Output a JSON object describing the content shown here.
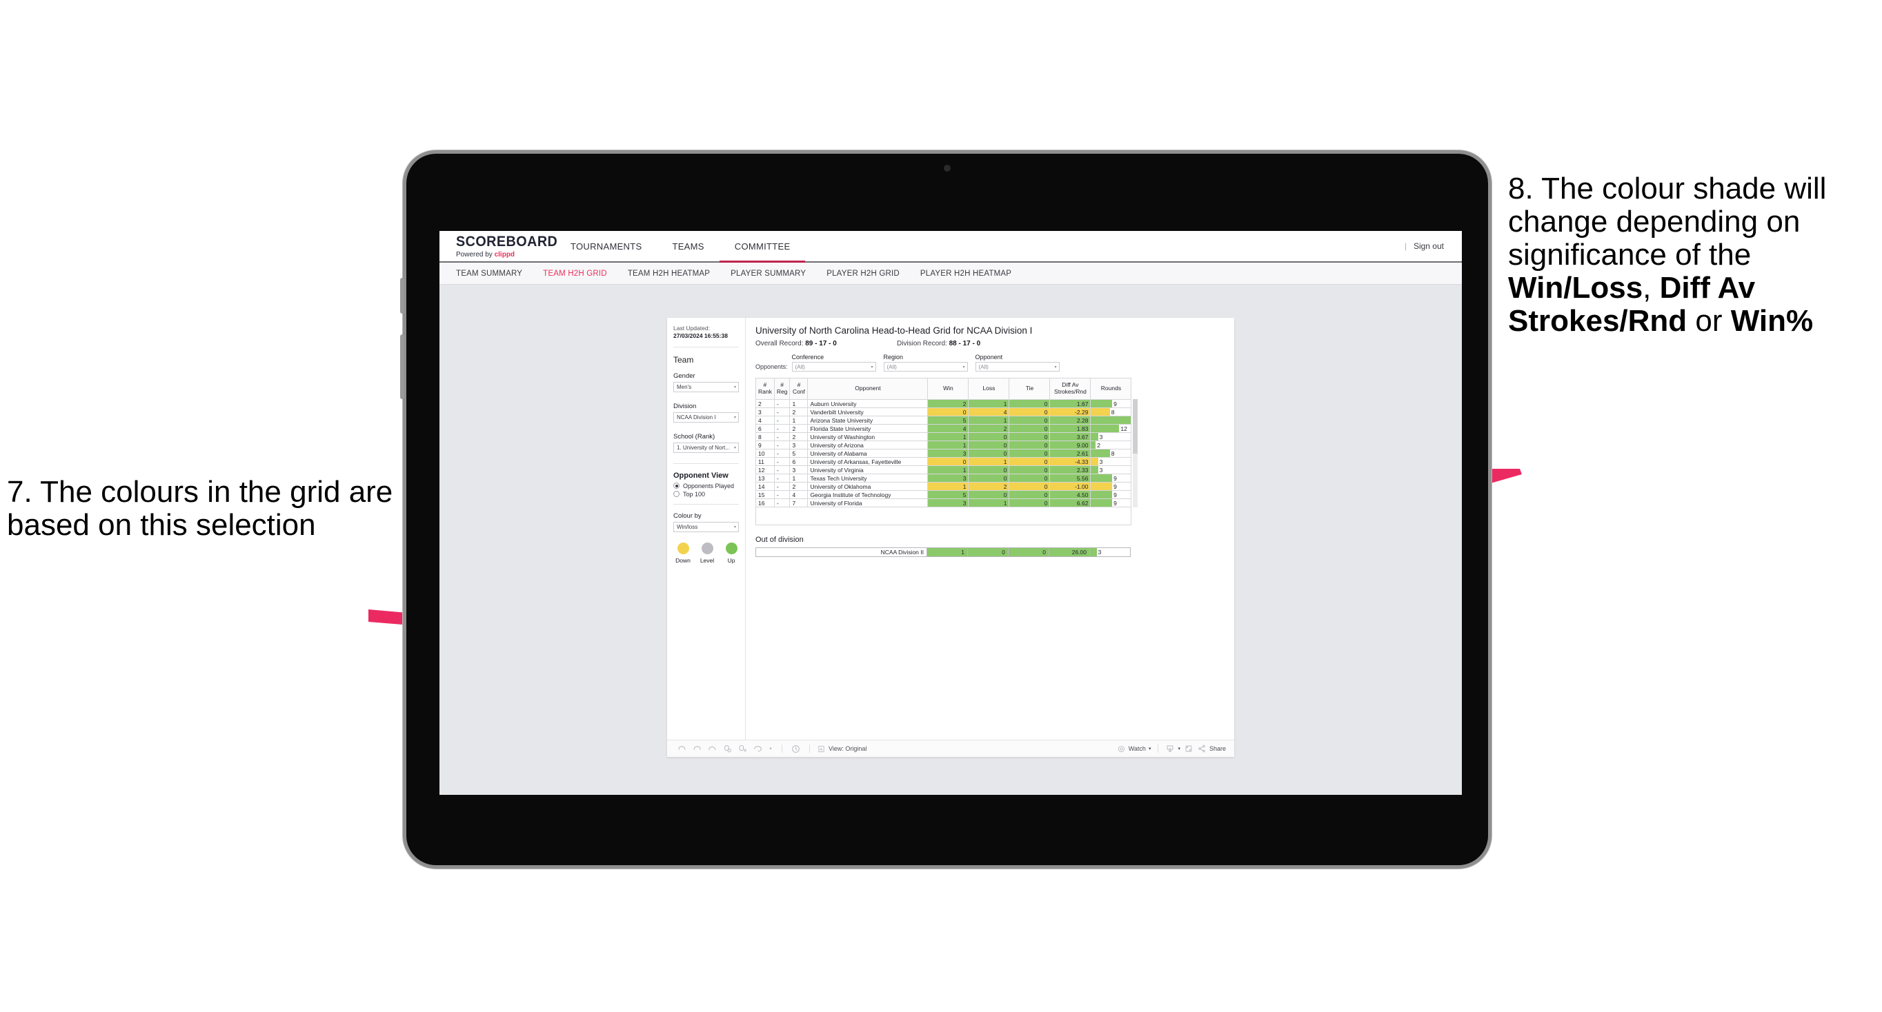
{
  "annotations": {
    "left": "7. The colours in the grid are based on this selection",
    "right_parts": [
      {
        "t": "8. The colour shade will change depending on significance of the ",
        "b": false
      },
      {
        "t": "Win/Loss",
        "b": true
      },
      {
        "t": ", ",
        "b": false
      },
      {
        "t": "Diff Av Strokes/Rnd",
        "b": true
      },
      {
        "t": " or ",
        "b": false
      },
      {
        "t": "Win%",
        "b": true
      }
    ],
    "arrow_color": "#ec2a62"
  },
  "app": {
    "logo_title": "SCOREBOARD",
    "logo_sub_prefix": "Powered by ",
    "logo_sub_brand": "clippd",
    "top_nav": [
      {
        "label": "TOURNAMENTS",
        "active": false
      },
      {
        "label": "TEAMS",
        "active": false
      },
      {
        "label": "COMMITTEE",
        "active": true
      }
    ],
    "sign_out": "Sign out",
    "sign_out_divider": "|",
    "sub_nav": [
      {
        "label": "TEAM SUMMARY",
        "active": false
      },
      {
        "label": "TEAM H2H GRID",
        "active": true
      },
      {
        "label": "TEAM H2H HEATMAP",
        "active": false
      },
      {
        "label": "PLAYER SUMMARY",
        "active": false
      },
      {
        "label": "PLAYER H2H GRID",
        "active": false
      },
      {
        "label": "PLAYER H2H HEATMAP",
        "active": false
      }
    ],
    "accent": "#e8305a"
  },
  "panel": {
    "last_updated_label": "Last Updated: ",
    "last_updated_value": "27/03/2024 16:55:38",
    "team_heading": "Team",
    "gender_label": "Gender",
    "gender_value": "Men's",
    "division_label": "Division",
    "division_value": "NCAA Division I",
    "school_label": "School (Rank)",
    "school_value": "1. University of Nort...",
    "opponent_view_heading": "Opponent View",
    "opponent_view_options": [
      {
        "label": "Opponents Played",
        "selected": true
      },
      {
        "label": "Top 100",
        "selected": false
      }
    ],
    "colour_by_label": "Colour by",
    "colour_by_value": "Win/loss",
    "legend": [
      {
        "label": "Down",
        "color": "#f3d24e"
      },
      {
        "label": "Level",
        "color": "#bcbcc2"
      },
      {
        "label": "Up",
        "color": "#7bc356"
      }
    ],
    "caret": "▾"
  },
  "viz": {
    "title": "University of North Carolina Head-to-Head Grid for NCAA Division I",
    "overall_label": "Overall Record: ",
    "overall_value": "89 - 17 - 0",
    "division_label": "Division Record: ",
    "division_value": "88 - 17 - 0",
    "opponents_lead": "Opponents:",
    "filters": [
      {
        "label": "Conference",
        "value": "(All)"
      },
      {
        "label": "Region",
        "value": "(All)"
      },
      {
        "label": "Opponent",
        "value": "(All)"
      }
    ],
    "caret": "▾"
  },
  "chart_data": {
    "type": "table",
    "title": "University of North Carolina Head-to-Head Grid for NCAA Division I",
    "columns": [
      "# Rank",
      "# Reg",
      "# Conf",
      "Opponent",
      "Win",
      "Loss",
      "Tie",
      "Diff Av Strokes/Rnd",
      "Rounds"
    ],
    "colour_by": "Win/loss",
    "rounds_max": 17,
    "rows": [
      {
        "rank": "2",
        "reg": "-",
        "conf": "1",
        "opponent": "Auburn University",
        "win": "2",
        "loss": "1",
        "tie": "0",
        "diff": "1.67",
        "rounds": "9",
        "state": "up"
      },
      {
        "rank": "3",
        "reg": "-",
        "conf": "2",
        "opponent": "Vanderbilt University",
        "win": "0",
        "loss": "4",
        "tie": "0",
        "diff": "-2.29",
        "rounds": "8",
        "state": "down"
      },
      {
        "rank": "4",
        "reg": "-",
        "conf": "1",
        "opponent": "Arizona State University",
        "win": "5",
        "loss": "1",
        "tie": "0",
        "diff": "2.28",
        "rounds": "17",
        "state": "up"
      },
      {
        "rank": "6",
        "reg": "-",
        "conf": "2",
        "opponent": "Florida State University",
        "win": "4",
        "loss": "2",
        "tie": "0",
        "diff": "1.83",
        "rounds": "12",
        "state": "up"
      },
      {
        "rank": "8",
        "reg": "-",
        "conf": "2",
        "opponent": "University of Washington",
        "win": "1",
        "loss": "0",
        "tie": "0",
        "diff": "3.67",
        "rounds": "3",
        "state": "up"
      },
      {
        "rank": "9",
        "reg": "-",
        "conf": "3",
        "opponent": "University of Arizona",
        "win": "1",
        "loss": "0",
        "tie": "0",
        "diff": "9.00",
        "rounds": "2",
        "state": "up"
      },
      {
        "rank": "10",
        "reg": "-",
        "conf": "5",
        "opponent": "University of Alabama",
        "win": "3",
        "loss": "0",
        "tie": "0",
        "diff": "2.61",
        "rounds": "8",
        "state": "up"
      },
      {
        "rank": "11",
        "reg": "-",
        "conf": "6",
        "opponent": "University of Arkansas, Fayetteville",
        "win": "0",
        "loss": "1",
        "tie": "0",
        "diff": "-4.33",
        "rounds": "3",
        "state": "down"
      },
      {
        "rank": "12",
        "reg": "-",
        "conf": "3",
        "opponent": "University of Virginia",
        "win": "1",
        "loss": "0",
        "tie": "0",
        "diff": "2.33",
        "rounds": "3",
        "state": "up"
      },
      {
        "rank": "13",
        "reg": "-",
        "conf": "1",
        "opponent": "Texas Tech University",
        "win": "3",
        "loss": "0",
        "tie": "0",
        "diff": "5.56",
        "rounds": "9",
        "state": "up"
      },
      {
        "rank": "14",
        "reg": "-",
        "conf": "2",
        "opponent": "University of Oklahoma",
        "win": "1",
        "loss": "2",
        "tie": "0",
        "diff": "-1.00",
        "rounds": "9",
        "state": "down"
      },
      {
        "rank": "15",
        "reg": "-",
        "conf": "4",
        "opponent": "Georgia Institute of Technology",
        "win": "5",
        "loss": "0",
        "tie": "0",
        "diff": "4.50",
        "rounds": "9",
        "state": "up"
      },
      {
        "rank": "16",
        "reg": "-",
        "conf": "7",
        "opponent": "University of Florida",
        "win": "3",
        "loss": "1",
        "tie": "0",
        "diff": "6.62",
        "rounds": "9",
        "state": "up"
      }
    ],
    "out_of_division": {
      "title": "Out of division",
      "row": {
        "opponent": "NCAA Division II",
        "win": "1",
        "loss": "0",
        "tie": "0",
        "diff": "26.00",
        "rounds": "3",
        "state": "up"
      }
    }
  },
  "toolbar": {
    "view_label": "View: Original",
    "watch_label": "Watch",
    "share_label": "Share",
    "caret": "▾",
    "divider": "|"
  }
}
